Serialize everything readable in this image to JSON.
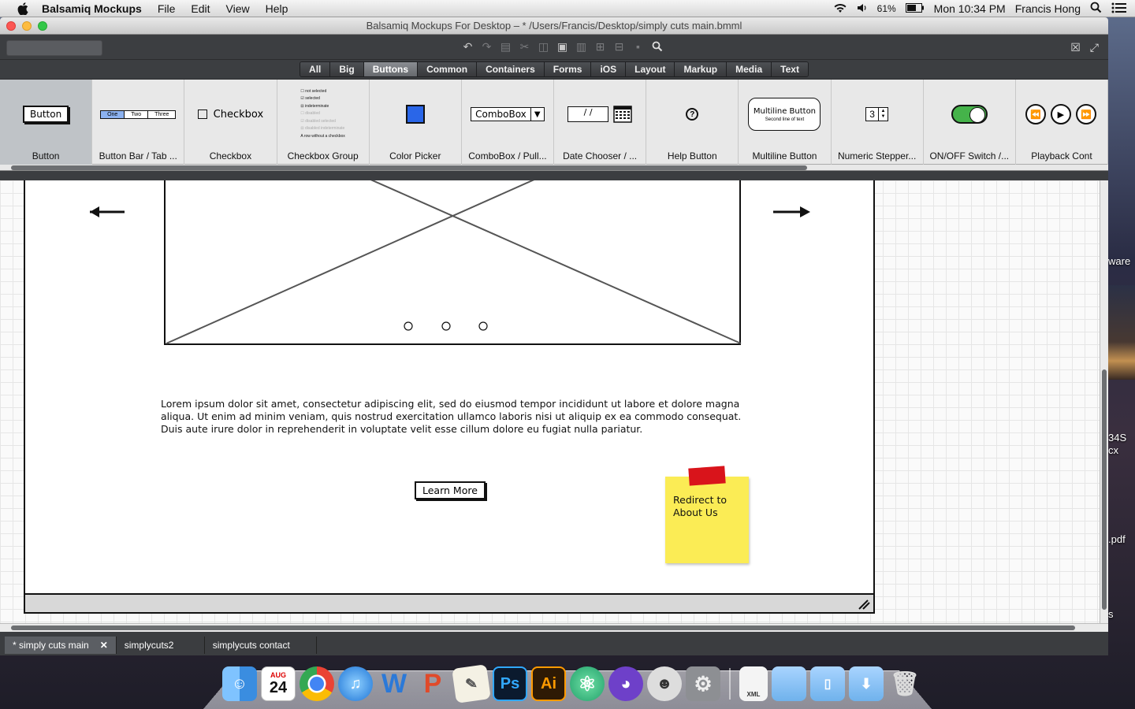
{
  "menubar": {
    "app_name": "Balsamiq Mockups",
    "items": [
      "File",
      "Edit",
      "View",
      "Help"
    ],
    "battery": "61%",
    "clock": "Mon 10:34 PM",
    "user": "Francis Hong"
  },
  "window": {
    "title": "Balsamiq Mockups For Desktop – * /Users/Francis/Desktop/simply cuts main.bmml"
  },
  "filters": {
    "items": [
      "All",
      "Big",
      "Buttons",
      "Common",
      "Containers",
      "Forms",
      "iOS",
      "Layout",
      "Markup",
      "Media",
      "Text"
    ],
    "active": "Buttons"
  },
  "library": {
    "items": [
      {
        "label": "Button",
        "preview": "Button"
      },
      {
        "label": "Button Bar / Tab ...",
        "preview": [
          "One",
          "Two",
          "Three"
        ]
      },
      {
        "label": "Checkbox",
        "preview": "Checkbox"
      },
      {
        "label": "Checkbox Group",
        "preview": [
          "not selected",
          "selected",
          "indeterminate",
          "disabled",
          "disabled selected",
          "disabled indeterminate",
          "A row without a checkbox"
        ]
      },
      {
        "label": "Color Picker"
      },
      {
        "label": "ComboBox / Pull...",
        "preview": "ComboBox"
      },
      {
        "label": "Date Chooser / ...",
        "preview": "/ /"
      },
      {
        "label": "Help Button",
        "preview": "?"
      },
      {
        "label": "Multiline Button",
        "preview": [
          "Multiline Button",
          "Second line of text"
        ]
      },
      {
        "label": "Numeric Stepper...",
        "preview": "3"
      },
      {
        "label": "ON/OFF Switch /..."
      },
      {
        "label": "Playback Cont"
      }
    ]
  },
  "mockup": {
    "lorem": "Lorem ipsum dolor sit amet, consectetur adipiscing elit, sed do eiusmod tempor incididunt ut labore et dolore magna aliqua. Ut enim ad minim veniam, quis nostrud exercitation ullamco laboris nisi ut aliquip ex ea commodo consequat. Duis aute irure dolor in reprehenderit in voluptate velit esse cillum dolore eu fugiat nulla pariatur.",
    "learn_more": "Learn More",
    "sticky_note": "Redirect to About Us",
    "carousel_dots": 3
  },
  "tabs": [
    {
      "label": "* simply cuts main",
      "active": true
    },
    {
      "label": "simplycuts2",
      "active": false
    },
    {
      "label": "simplycuts contact",
      "active": false
    }
  ],
  "desktop_labels": [
    "ware",
    "34S",
    "cx",
    ".pdf",
    "s"
  ],
  "dock": {
    "icons": [
      "finder-icon",
      "calendar-icon",
      "chrome-icon",
      "itunes-icon",
      "word-icon",
      "powerpoint-icon",
      "textedit-icon",
      "photoshop-icon",
      "illustrator-icon",
      "atom-icon",
      "github-icon",
      "automator-icon",
      "system-preferences-icon",
      "xml-file-icon",
      "folder-icon",
      "documents-icon",
      "downloads-icon",
      "trash-icon"
    ],
    "calendar_month": "AUG",
    "calendar_day": "24",
    "photoshop_label": "Ps",
    "illustrator_label": "Ai",
    "word_label": "W",
    "powerpoint_label": "P",
    "xml_label": "XML"
  },
  "colors": {
    "accent_blue": "#2a66e8",
    "switch_green": "#45b34a",
    "sticky_yellow": "#fbec55",
    "tape_red": "#d9141b"
  }
}
